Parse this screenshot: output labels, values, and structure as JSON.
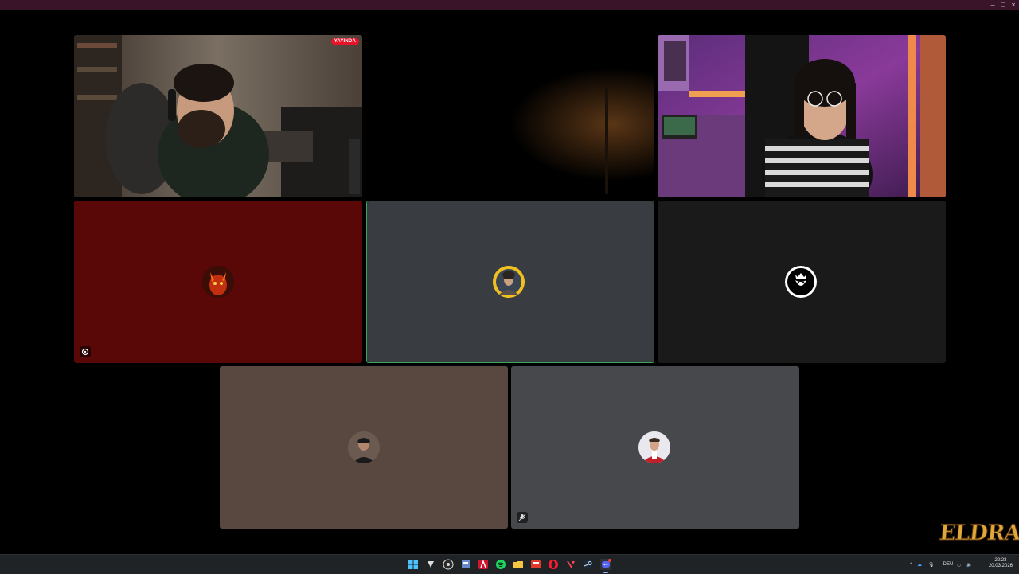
{
  "window": {
    "controls": {
      "minimize": "–",
      "maximize": "□",
      "close": "×"
    }
  },
  "tiles": [
    {
      "id": "streamer-cam",
      "type": "video",
      "badge": "YAYINDA"
    },
    {
      "id": "empty-center",
      "type": "video"
    },
    {
      "id": "webcam-girl",
      "type": "video"
    },
    {
      "id": "user-red",
      "type": "avatar",
      "bg": "#5a0707"
    },
    {
      "id": "user-speaking",
      "type": "avatar",
      "bg": "#393c40",
      "speaking": true
    },
    {
      "id": "user-lion",
      "type": "avatar",
      "bg": "#1a1a1a"
    },
    {
      "id": "user-brown",
      "type": "avatar",
      "bg": "#594840"
    },
    {
      "id": "user-grey",
      "type": "avatar",
      "bg": "#46484c",
      "muted": true
    }
  ],
  "colors": {
    "accent_speaking": "#3ba55c",
    "title_bar": "#3a1428",
    "taskbar": "#202326"
  },
  "taskbar": {
    "apps": [
      "windows-start",
      "epic-games",
      "obs",
      "files",
      "adobe",
      "spotify",
      "explorer",
      "media",
      "opera",
      "valorant",
      "steam",
      "discord"
    ],
    "tray": {
      "language": "DEU",
      "time": "22:23",
      "date": "20.03.2026"
    }
  },
  "watermark": {
    "text": "ELDRAUN"
  }
}
